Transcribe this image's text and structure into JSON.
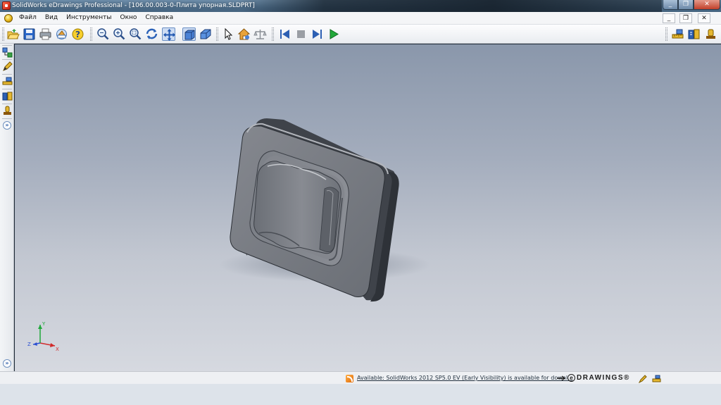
{
  "window": {
    "title": "SolidWorks eDrawings Professional - [106.00.003-0-Плита упорная.SLDPRT]",
    "controls": {
      "minimize": "_",
      "restore": "❐",
      "close": "✕"
    }
  },
  "menubar": {
    "items": [
      "Файл",
      "Вид",
      "Инструменты",
      "Окно",
      "Справка"
    ],
    "doc_controls": {
      "minimize": "_",
      "restore": "❐",
      "close": "✕"
    }
  },
  "toolbar": {
    "icons": [
      "open-icon",
      "save-icon",
      "print-icon",
      "send-icon",
      "help-icon",
      "zoom-to-fit-icon",
      "zoom-in-out-icon",
      "zoom-to-area-icon",
      "rotate-icon",
      "pan-icon",
      "shaded-icon",
      "perspective-icon",
      "select-icon",
      "home-view-icon",
      "measure-balance-icon",
      "rewind-icon",
      "stop-icon",
      "step-forward-icon",
      "play-icon",
      "markup-measure-icon",
      "stamp-icon",
      "move-component-icon"
    ],
    "active": [
      "pan-icon",
      "shaded-icon"
    ]
  },
  "status": {
    "message": "Available: SolidWorks 2012 SP5.0 EV (Early Visibility) is available for downl...",
    "brand": "DRAWINGS®",
    "brand_prefix": "e"
  },
  "colors": {
    "title_bar": "#4f6f8c",
    "viewport_top": "#8a97ab",
    "viewport_bottom": "#d6d9e0",
    "part": "#777b82"
  }
}
